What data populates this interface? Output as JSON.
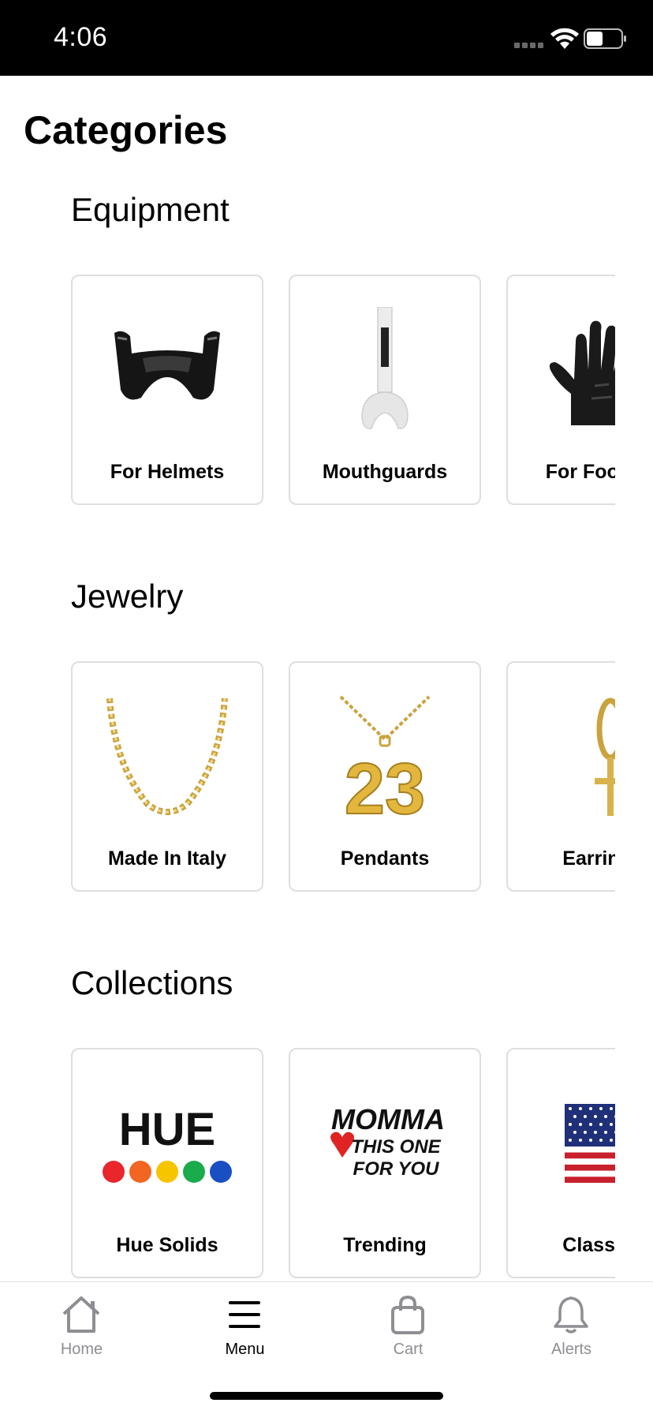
{
  "status_bar": {
    "time": "4:06"
  },
  "page": {
    "title": "Categories"
  },
  "sections": [
    {
      "title": "Equipment",
      "cards": [
        {
          "label": "For Helmets",
          "icon": "helmet-visor-icon"
        },
        {
          "label": "Mouthguards",
          "icon": "mouthguard-icon"
        },
        {
          "label": "For Football",
          "icon": "football-glove-icon"
        }
      ]
    },
    {
      "title": "Jewelry",
      "cards": [
        {
          "label": "Made In Italy",
          "icon": "gold-chain-icon"
        },
        {
          "label": "Pendants",
          "icon": "number-pendant-icon"
        },
        {
          "label": "Earrings",
          "icon": "cross-earring-icon"
        }
      ]
    },
    {
      "title": "Collections",
      "cards": [
        {
          "label": "Hue Solids",
          "icon": "hue-logo",
          "logo_text": "HUE"
        },
        {
          "label": "Trending",
          "icon": "momma-logo",
          "logo_lines": [
            "MOMMA",
            "THIS ONE",
            "FOR YOU"
          ]
        },
        {
          "label": "Classics",
          "icon": "us-flag-icon"
        }
      ]
    }
  ],
  "hue_colors": [
    "#e8262b",
    "#f26522",
    "#f7c400",
    "#1aab4b",
    "#1a4fc4"
  ],
  "tab_bar": {
    "tabs": [
      {
        "label": "Home",
        "icon": "home-icon",
        "active": false
      },
      {
        "label": "Menu",
        "icon": "menu-icon",
        "active": true
      },
      {
        "label": "Cart",
        "icon": "cart-bag-icon",
        "active": false
      },
      {
        "label": "Alerts",
        "icon": "bell-icon",
        "active": false
      }
    ]
  },
  "colors": {
    "inactive_tab": "#8e8e93",
    "active_tab": "#000000",
    "card_border": "#dedede"
  }
}
